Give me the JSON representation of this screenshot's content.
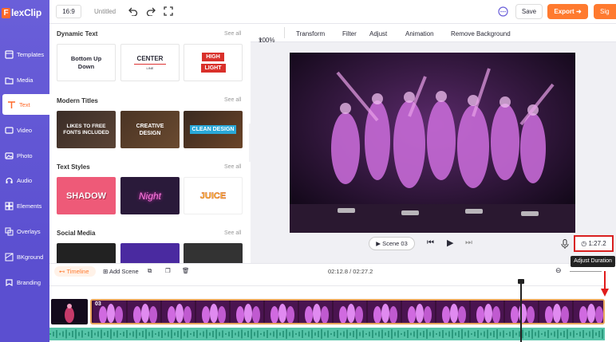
{
  "brand": {
    "logo_letter": "F",
    "logo_text": "lexClip"
  },
  "sidebar": {
    "items": [
      {
        "label": "Templates",
        "icon": "templates-icon"
      },
      {
        "label": "Media",
        "icon": "media-icon"
      },
      {
        "label": "Text",
        "icon": "text-icon",
        "active": true
      },
      {
        "label": "Video",
        "icon": "video-icon"
      },
      {
        "label": "Photo",
        "icon": "photo-icon"
      },
      {
        "label": "Audio",
        "icon": "audio-icon"
      },
      {
        "label": "Elements",
        "icon": "elements-icon"
      },
      {
        "label": "Overlays",
        "icon": "overlays-icon"
      },
      {
        "label": "BKground",
        "icon": "background-icon"
      },
      {
        "label": "Branding",
        "icon": "branding-icon"
      }
    ]
  },
  "topbar": {
    "ratio": "16:9",
    "title": "Untitled",
    "save": "Save",
    "export": "Export",
    "sign": "Sig"
  },
  "panel": {
    "sections": [
      {
        "title": "Dynamic Text",
        "see_all": "See all",
        "items": [
          "Bottom Up Down",
          "CENTER",
          "LINE",
          "HIGH",
          "LIGHT"
        ]
      },
      {
        "title": "Modern Titles",
        "see_all": "See all",
        "items": [
          "LIKES TO FREE FONTS INCLUDED",
          "CREATIVE DESIGN",
          "CLEAN DESIGN"
        ]
      },
      {
        "title": "Text Styles",
        "see_all": "See all",
        "items": [
          "SHADOW",
          "Night",
          "JUICE"
        ]
      },
      {
        "title": "Social Media",
        "see_all": "See all",
        "items": []
      }
    ]
  },
  "toolbar": {
    "zoom": "100%",
    "transform": "Transform",
    "filter": "Filter",
    "adjust": "Adjust",
    "animation": "Animation",
    "remove_bg": "Remove Background"
  },
  "player": {
    "scene": "Scene 03",
    "duration": "1:27.2",
    "tooltip": "Adjust Duration"
  },
  "timeline": {
    "label": "Timeline",
    "add_scene": "Add Scene",
    "time": "02:12.8 / 02:27.2",
    "scene_number": "03"
  },
  "colors": {
    "accent": "#ff7a2f",
    "sidebar": "#5b4fd0",
    "highlight": "#d92020"
  }
}
